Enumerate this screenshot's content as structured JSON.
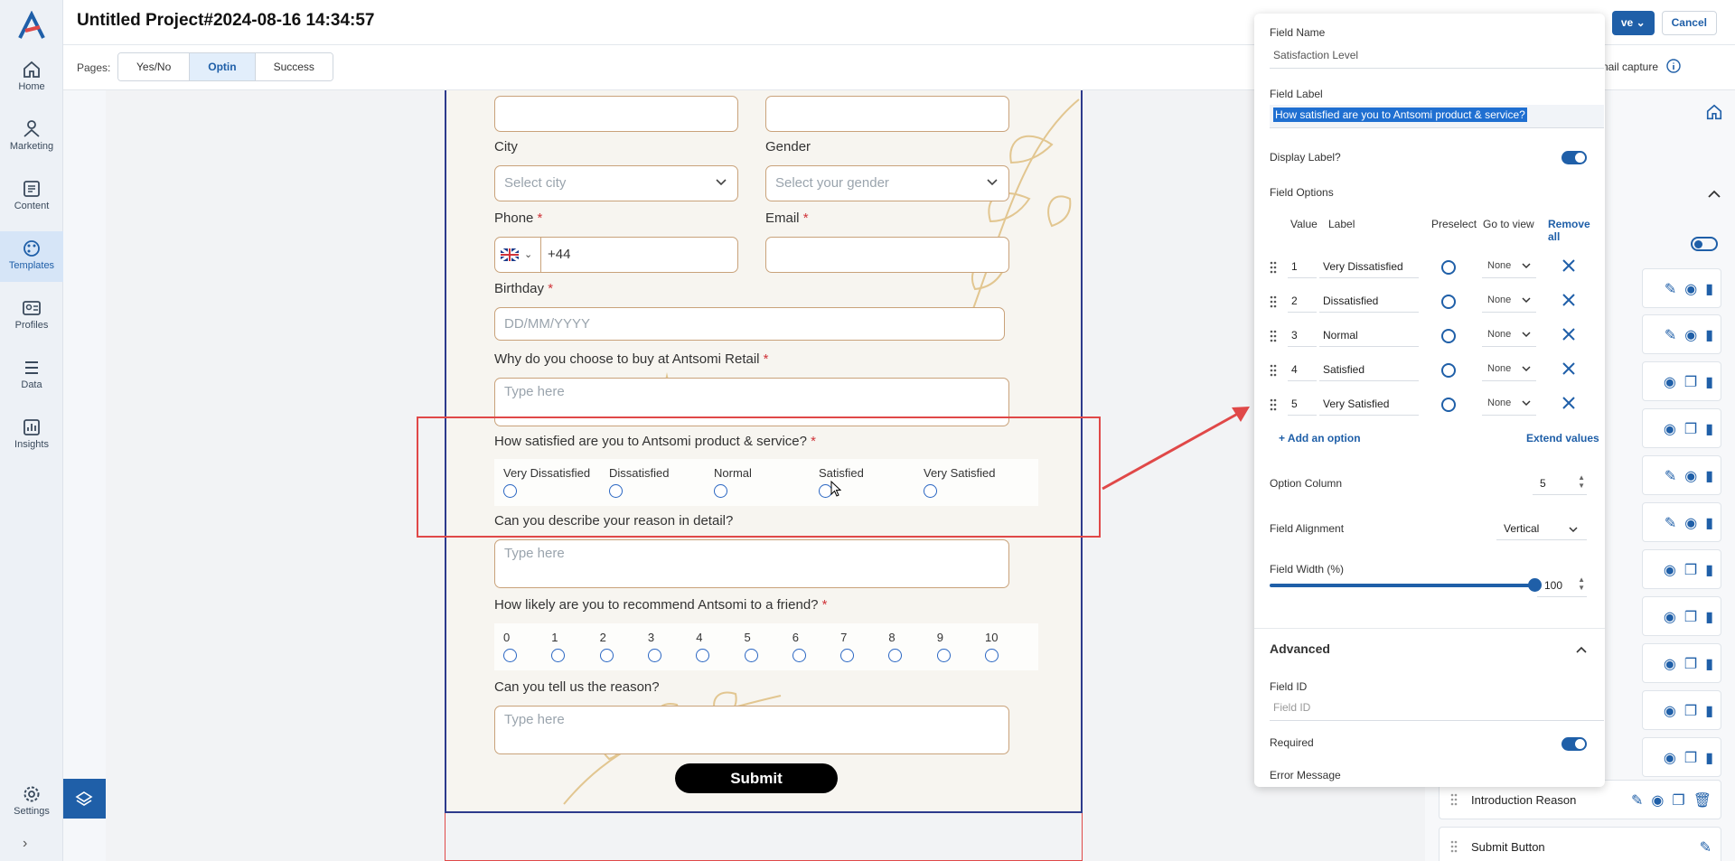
{
  "app": {
    "title": "Untitled Project#2024-08-16 14:34:57",
    "save_label": "ve",
    "cancel_label": "Cancel",
    "thumbnail_label": "humbnail capture"
  },
  "nav": {
    "items": [
      {
        "label": "Home"
      },
      {
        "label": "Marketing"
      },
      {
        "label": "Content"
      },
      {
        "label": "Templates"
      },
      {
        "label": "Profiles"
      },
      {
        "label": "Data"
      },
      {
        "label": "Insights"
      }
    ],
    "settings": "Settings"
  },
  "pages": {
    "label": "Pages:",
    "tabs": [
      "Yes/No",
      "Optin",
      "Success"
    ],
    "active": "Optin"
  },
  "form": {
    "city_label": "City",
    "city_placeholder": "Select city",
    "gender_label": "Gender",
    "gender_placeholder": "Select your gender",
    "phone_label": "Phone",
    "phone_code": "+44",
    "email_label": "Email",
    "birthday_label": "Birthday",
    "birthday_placeholder": "DD/MM/YYYY",
    "why_label": "Why do you choose to buy at Antsomi Retail",
    "why_placeholder": "Type here",
    "sat_label": "How satisfied are you to Antsomi product & service?",
    "sat_options": [
      "Very Dissatisfied",
      "Dissatisfied",
      "Normal",
      "Satisfied",
      "Very Satisfied"
    ],
    "describe_label": "Can you describe your reason in detail?",
    "describe_placeholder": "Type here",
    "recommend_label": "How likely are you to recommend Antsomi to a friend?",
    "nps": [
      "0",
      "1",
      "2",
      "3",
      "4",
      "5",
      "6",
      "7",
      "8",
      "9",
      "10"
    ],
    "reason_label": "Can you tell us the reason?",
    "reason_placeholder": "Type here",
    "submit": "Submit",
    "required_mark": "*"
  },
  "panel": {
    "field_name_label": "Field Name",
    "field_name": "Satisfaction Level",
    "field_label_label": "Field Label",
    "field_label": "How satisfied are you to Antsomi product & service?",
    "display_label": "Display Label?",
    "field_options": "Field Options",
    "headers": {
      "value": "Value",
      "label": "Label",
      "preselect": "Preselect",
      "go_to_view": "Go to view",
      "remove_all": "Remove all"
    },
    "options": [
      {
        "value": "1",
        "label": "Very Dissatisfied",
        "view": "None"
      },
      {
        "value": "2",
        "label": "Dissatisfied",
        "view": "None"
      },
      {
        "value": "3",
        "label": "Normal",
        "view": "None"
      },
      {
        "value": "4",
        "label": "Satisfied",
        "view": "None"
      },
      {
        "value": "5",
        "label": "Very Satisfied",
        "view": "None"
      }
    ],
    "add_option": "+ Add an option",
    "extend_values": "Extend values",
    "option_column_label": "Option Column",
    "option_column": "5",
    "alignment_label": "Field Alignment",
    "alignment": "Vertical",
    "width_label": "Field Width (%)",
    "width": "100",
    "advanced": "Advanced",
    "field_id_label": "Field ID",
    "field_id_placeholder": "Field ID",
    "required_label": "Required",
    "error_label": "Error Message"
  },
  "layers": {
    "items": [
      "Introduction Reason",
      "Submit Button"
    ]
  },
  "colors": {
    "accent": "#1f5fa8",
    "highlight": "#e04848"
  }
}
